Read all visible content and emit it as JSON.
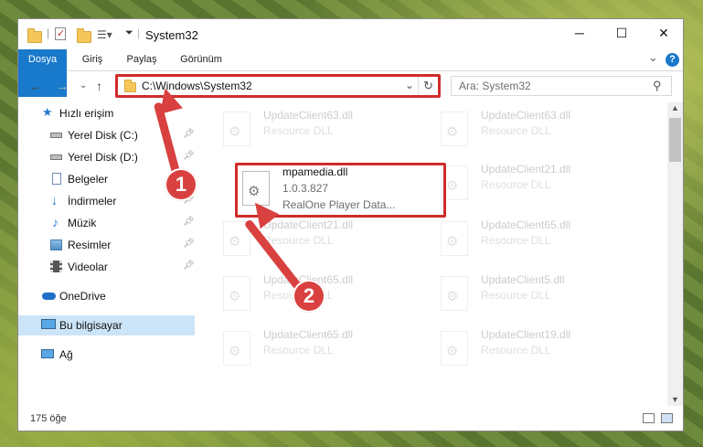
{
  "window": {
    "title": "System32",
    "minimize": "─",
    "maximize": "☐",
    "close": "✕"
  },
  "ribbon": {
    "tabs": [
      "Dosya",
      "Giriş",
      "Paylaş",
      "Görünüm"
    ],
    "chevron": "⌄",
    "help": "?"
  },
  "address_bar": {
    "path": "C:\\Windows\\System32",
    "search_placeholder": "Ara: System32"
  },
  "sidebar": {
    "items": [
      {
        "label": "Hızlı erişim",
        "icon": "star-icon",
        "pinned": false
      },
      {
        "label": "Yerel Disk (C:)",
        "icon": "drive-icon",
        "pinned": true
      },
      {
        "label": "Yerel Disk (D:)",
        "icon": "drive-icon",
        "pinned": true
      },
      {
        "label": "Belgeler",
        "icon": "document-icon",
        "pinned": true
      },
      {
        "label": "İndirmeler",
        "icon": "download-icon",
        "pinned": true
      },
      {
        "label": "Müzik",
        "icon": "music-icon",
        "pinned": true
      },
      {
        "label": "Resimler",
        "icon": "pictures-icon",
        "pinned": true
      },
      {
        "label": "Videolar",
        "icon": "video-icon",
        "pinned": true
      },
      {
        "label": "OneDrive",
        "icon": "cloud-icon",
        "pinned": false
      },
      {
        "label": "Bu bilgisayar",
        "icon": "computer-icon",
        "pinned": false
      },
      {
        "label": "Ağ",
        "icon": "network-icon",
        "pinned": false
      }
    ]
  },
  "files": {
    "highlighted": {
      "name": "mpamedia.dll",
      "version": "1.0.3.827",
      "description": "RealOne Player Data..."
    },
    "background": [
      {
        "name": "UpdateClient63.dll",
        "type": "Resource DLL"
      },
      {
        "name": "UpdateClient63.dll",
        "type": "Resource DLL"
      },
      {
        "name": "UpdateClient21.dll",
        "type": "Resource DLL"
      },
      {
        "name": "UpdateClient21.dll",
        "type": "Resource DLL"
      },
      {
        "name": "UpdateClient65.dll",
        "type": "Resource DLL"
      },
      {
        "name": "UpdateClient65.dll",
        "type": "Resource DLL"
      },
      {
        "name": "UpdateClient5.dll",
        "type": "Resource DLL"
      },
      {
        "name": "UpdateClient65.dll",
        "type": "Resource DLL"
      },
      {
        "name": "UpdateClient19.dll",
        "type": "Resource DLL"
      }
    ]
  },
  "status_bar": {
    "count": "175 öğe"
  },
  "annotations": {
    "step1": "1",
    "step2": "2"
  },
  "colors": {
    "accent": "#1979ca",
    "highlight_border": "#d12b2b",
    "annotation": "#d8413f",
    "selected_nav": "#cce4f7"
  }
}
